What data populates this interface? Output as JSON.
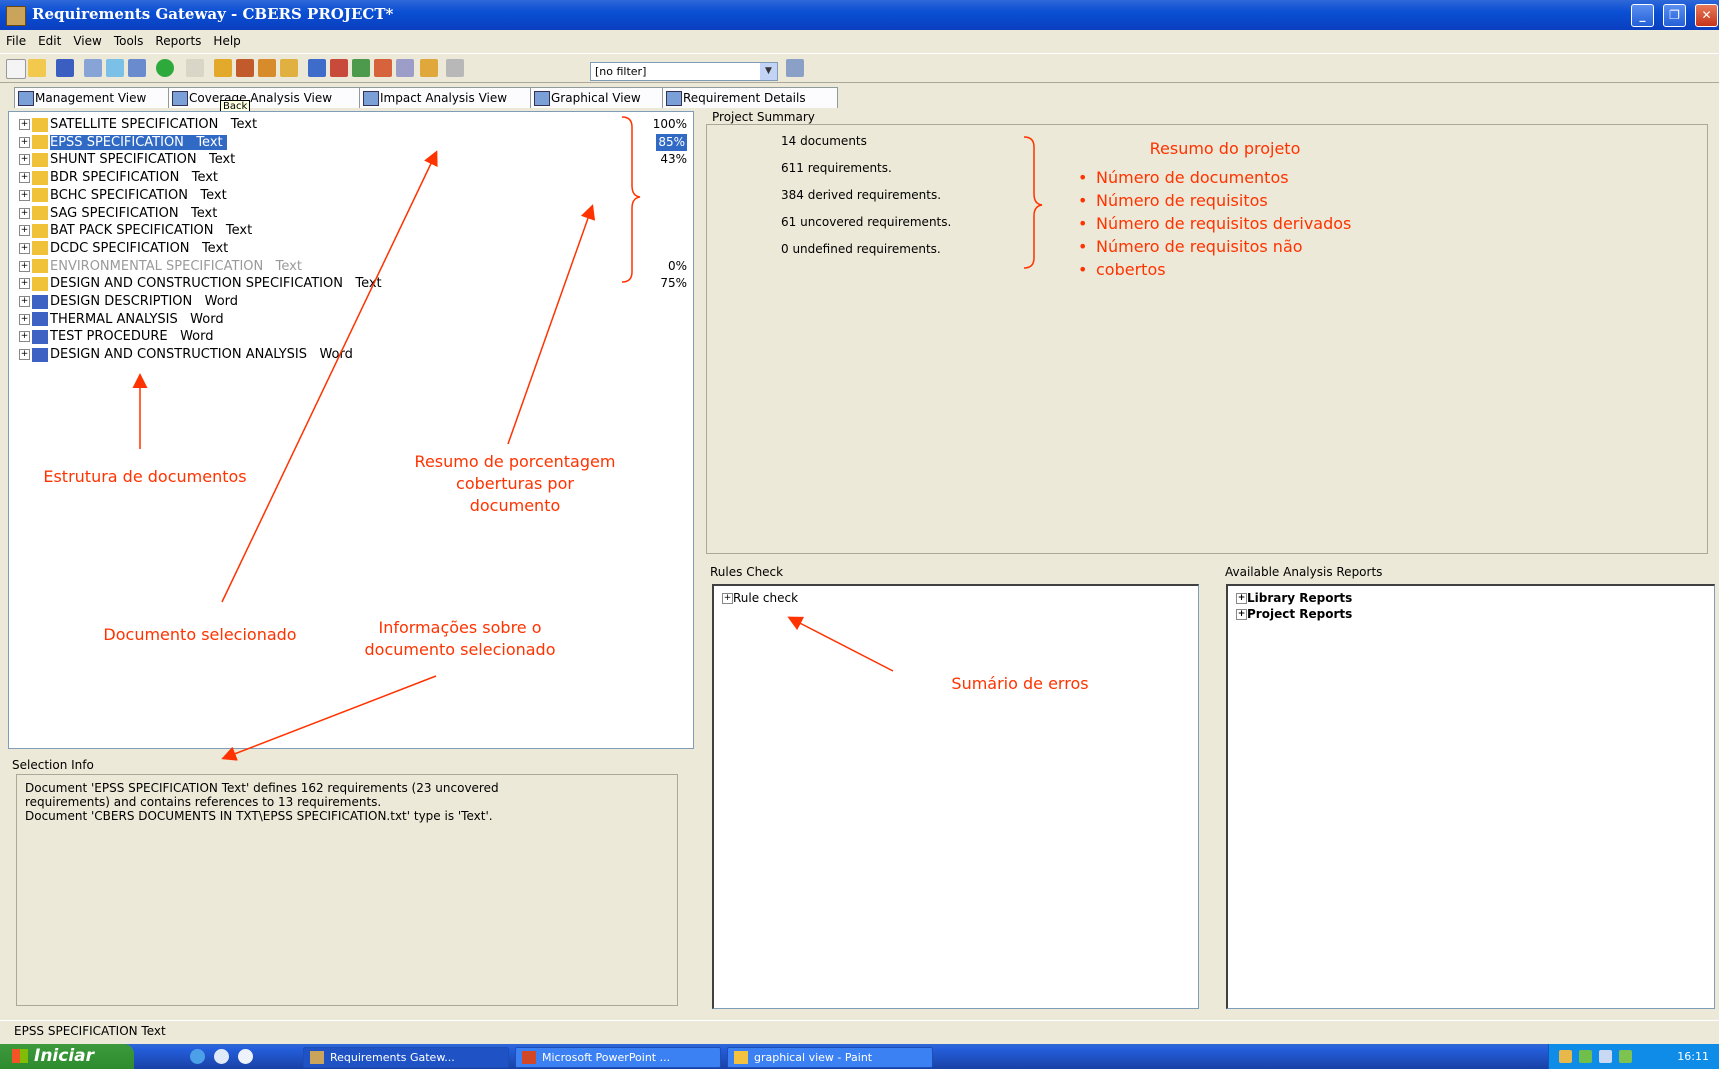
{
  "window": {
    "title": "Requirements Gateway - CBERS PROJECT*"
  },
  "menu": [
    "File",
    "Edit",
    "View",
    "Tools",
    "Reports",
    "Help"
  ],
  "toolbar": {
    "filter_value": "[no filter]"
  },
  "tabs": [
    "Management View",
    "Coverage Analysis View",
    "Impact Analysis View",
    "Graphical View",
    "Requirement Details"
  ],
  "tooltip": "Back",
  "tree": [
    {
      "name": "SATELLITE SPECIFICATION",
      "type": "Text",
      "pct": "100%"
    },
    {
      "name": "EPSS SPECIFICATION",
      "type": "Text",
      "pct": "85%"
    },
    {
      "name": "SHUNT SPECIFICATION",
      "type": "Text",
      "pct": "43%"
    },
    {
      "name": "BDR SPECIFICATION",
      "type": "Text",
      "pct": ""
    },
    {
      "name": "BCHC SPECIFICATION",
      "type": "Text",
      "pct": ""
    },
    {
      "name": "SAG SPECIFICATION",
      "type": "Text",
      "pct": ""
    },
    {
      "name": "BAT PACK SPECIFICATION",
      "type": "Text",
      "pct": ""
    },
    {
      "name": "DCDC SPECIFICATION",
      "type": "Text",
      "pct": ""
    },
    {
      "name": "ENVIRONMENTAL SPECIFICATION",
      "type": "Text",
      "pct": "0%"
    },
    {
      "name": "DESIGN AND CONSTRUCTION SPECIFICATION",
      "type": "Text",
      "pct": "75%"
    },
    {
      "name": "DESIGN DESCRIPTION",
      "type": "Word",
      "pct": ""
    },
    {
      "name": "THERMAL ANALYSIS",
      "type": "Word",
      "pct": ""
    },
    {
      "name": "TEST PROCEDURE",
      "type": "Word",
      "pct": ""
    },
    {
      "name": "DESIGN AND CONSTRUCTION ANALYSIS",
      "type": "Word",
      "pct": ""
    }
  ],
  "selection_info": {
    "title": "Selection Info",
    "lines": [
      "Document 'EPSS SPECIFICATION   Text' defines 162 requirements (23 uncovered",
      "requirements) and contains references to 13 requirements.",
      "Document 'CBERS DOCUMENTS IN TXT\\EPSS SPECIFICATION.txt' type is 'Text'."
    ]
  },
  "project_summary": {
    "title": "Project Summary",
    "lines": [
      "14 documents",
      "611 requirements.",
      "384 derived requirements.",
      "61 uncovered requirements.",
      "0 undefined requirements."
    ]
  },
  "rules_check": {
    "title": "Rules Check",
    "node": "Rule check"
  },
  "reports": {
    "title": "Available Analysis Reports",
    "nodes": [
      "Library Reports",
      "Project Reports"
    ]
  },
  "status_bar": "EPSS SPECIFICATION   Text",
  "taskbar": {
    "start": "Iniciar",
    "items": [
      "Requirements Gatew...",
      "Microsoft PowerPoint ...",
      "graphical view - Paint"
    ],
    "clock": "16:11"
  },
  "annotations": {
    "resumo_projeto": "Resumo do projeto",
    "resumo_list": [
      "Número de documentos",
      "Número de requisitos",
      "Número de requisitos derivados",
      "Número de requisitos não",
      "cobertos"
    ],
    "estrutura": "Estrutura de documentos",
    "resumo_pct": [
      "Resumo de porcentagem",
      "coberturas por",
      "documento"
    ],
    "doc_sel": "Documento selecionado",
    "info_sel": [
      "Informações sobre o",
      "documento selecionado"
    ],
    "sumario": "Sumário de erros"
  },
  "colors": {
    "title_bar": "#0a4fd4",
    "selection": "#316ac5",
    "annotation": "#ff3300"
  }
}
